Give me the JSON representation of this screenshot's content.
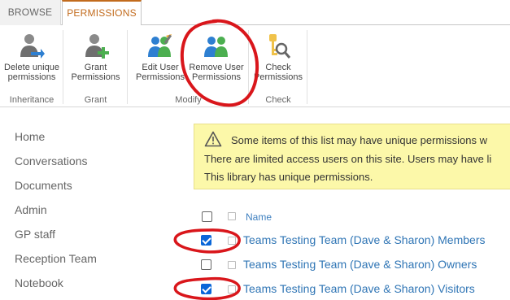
{
  "tabs": {
    "browse": "BROWSE",
    "permissions": "PERMISSIONS"
  },
  "ribbon": {
    "groups": {
      "inheritance": "Inheritance",
      "grant": "Grant",
      "modify": "Modify",
      "check": "Check"
    },
    "buttons": {
      "delete_unique": [
        "Delete unique",
        "permissions"
      ],
      "grant": [
        "Grant",
        "Permissions"
      ],
      "edit_user": [
        "Edit User",
        "Permissions"
      ],
      "remove_user": [
        "Remove User",
        "Permissions"
      ],
      "check": [
        "Check",
        "Permissions"
      ]
    }
  },
  "nav": [
    "Home",
    "Conversations",
    "Documents",
    "Admin",
    "GP staff",
    "Reception Team",
    "Notebook"
  ],
  "warning": {
    "line1": "Some items of this list may have unique permissions w",
    "line2": "There are limited access users on this site. Users may have li",
    "line3": "This library has unique permissions."
  },
  "list": {
    "column_name": "Name",
    "rows": [
      {
        "name": "Teams Testing Team (Dave & Sharon) Members",
        "checked": true
      },
      {
        "name": "Teams Testing Team (Dave & Sharon) Owners",
        "checked": false
      },
      {
        "name": "Teams Testing Team (Dave & Sharon) Visitors",
        "checked": true
      }
    ]
  },
  "colors": {
    "accent": "#c26b1d",
    "link": "#2f75b5",
    "warning_bg": "#fcf8a9",
    "annotation": "#d9161b"
  }
}
